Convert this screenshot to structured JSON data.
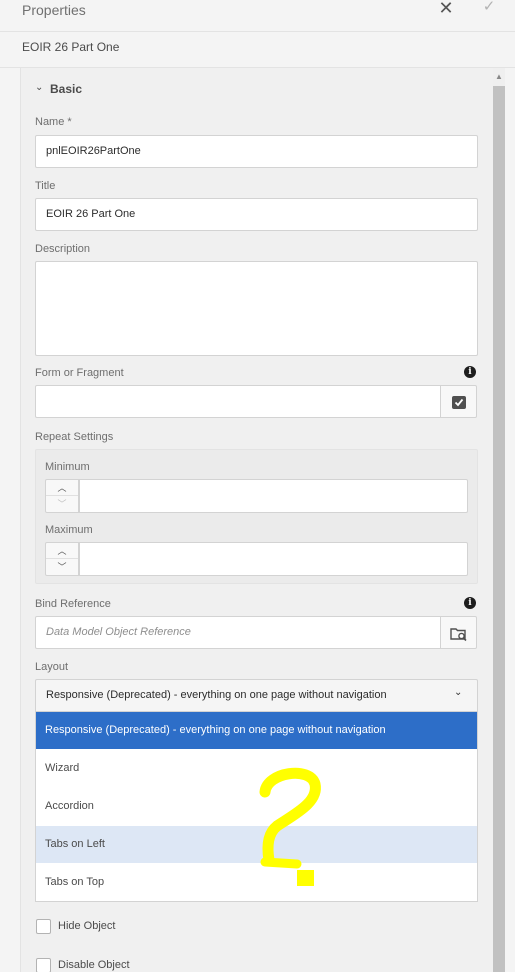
{
  "header": {
    "title": "Properties",
    "close_icon": "close-icon",
    "confirm_icon": "check-icon"
  },
  "subheader": {
    "title": "EOIR 26 Part One"
  },
  "accordion": {
    "label": "Basic"
  },
  "fields": {
    "name": {
      "label": "Name *",
      "value": "pnlEOIR26PartOne"
    },
    "title": {
      "label": "Title",
      "value": "EOIR 26 Part One"
    },
    "description": {
      "label": "Description",
      "value": ""
    },
    "form_or_fragment": {
      "label": "Form or Fragment",
      "value": ""
    },
    "bind_reference": {
      "label": "Bind Reference",
      "placeholder": "Data Model Object Reference"
    }
  },
  "repeat_settings": {
    "label": "Repeat Settings",
    "minimum": {
      "label": "Minimum",
      "value": ""
    },
    "maximum": {
      "label": "Maximum",
      "value": ""
    }
  },
  "layout": {
    "label": "Layout",
    "selected": "Responsive (Deprecated) - everything on one page without navigation",
    "options": [
      "Responsive (Deprecated) - everything on one page without navigation",
      "Wizard",
      "Accordion",
      "Tabs on Left",
      "Tabs on Top"
    ],
    "highlighted_option": "Tabs on Left"
  },
  "checkboxes": {
    "hide_object": {
      "label": "Hide Object",
      "checked": false
    },
    "disable_object": {
      "label": "Disable Object",
      "checked": false
    }
  },
  "annotation": {
    "color": "#ffff00"
  },
  "colors": {
    "accent": "#2d6ec8",
    "hover": "#dde7f5"
  }
}
